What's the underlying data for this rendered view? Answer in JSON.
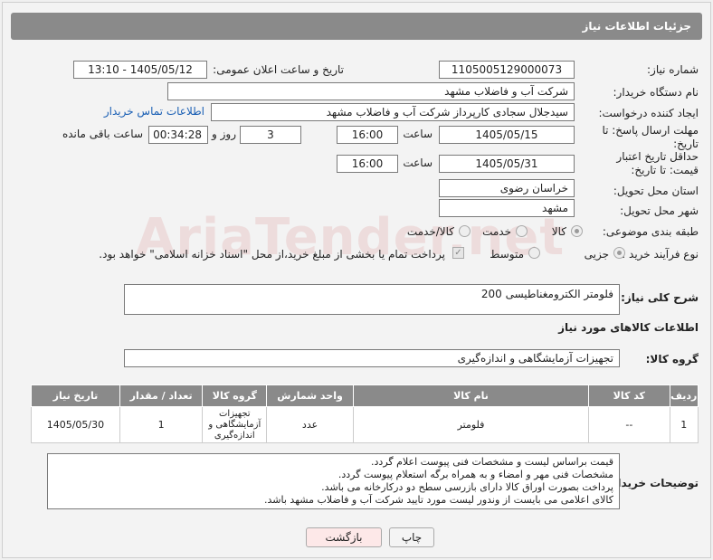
{
  "header": {
    "title": "جزئیات اطلاعات نیاز"
  },
  "watermark": "AriaTender.net",
  "fields": {
    "need_number_label": "شماره نیاز:",
    "need_number": "1105005129000073",
    "announce_label": "تاریخ و ساعت اعلان عمومی:",
    "announce_value": "1405/05/12 - 13:10",
    "buyer_org_label": "نام دستگاه خریدار:",
    "buyer_org": "شرکت آب و فاضلاب مشهد",
    "creator_label": "ایجاد کننده درخواست:",
    "creator": "سیدجلال سجادی کارپرداز شرکت آب و فاضلاب مشهد",
    "contact_link": "اطلاعات تماس خریدار",
    "deadline_label": "مهلت ارسال پاسخ: تا تاریخ:",
    "deadline_date": "1405/05/15",
    "time_word": "ساعت",
    "deadline_time": "16:00",
    "days": "3",
    "days_word": "روز و",
    "remaining": "00:34:28",
    "remaining_word": "ساعت باقی مانده",
    "validity_label": "حداقل تاریخ اعتبار قیمت: تا تاریخ:",
    "validity_date": "1405/05/31",
    "validity_time": "16:00",
    "province_label": "استان محل تحویل:",
    "province": "خراسان رضوی",
    "city_label": "شهر محل تحویل:",
    "city": "مشهد",
    "category_label": "طبقه بندی موضوعی:",
    "cat_goods": "کالا",
    "cat_service": "خدمت",
    "cat_both": "کالا/خدمت",
    "process_label": "نوع فرآیند خرید :",
    "proc_partial": "جزیی",
    "proc_medium": "متوسط",
    "payment_note": "پرداخت تمام یا بخشی از مبلغ خرید،از محل \"اسناد خزانه اسلامی\" خواهد بود."
  },
  "general_desc_label": "شرح کلی نیاز:",
  "general_desc": "فلومتر الکترومغناطیسی 200",
  "goods_section_title": "اطلاعات کالاهای مورد نیاز",
  "goods_group_label": "گروه کالا:",
  "goods_group": "تجهیزات آزمایشگاهی و اندازه‌گیری",
  "table": {
    "headers": [
      "ردیف",
      "کد کالا",
      "نام کالا",
      "واحد شمارش",
      "گروه کالا",
      "تعداد / مقدار",
      "تاریخ نیاز"
    ],
    "rows": [
      [
        "1",
        "--",
        "فلومتر",
        "عدد",
        "تجهیزات آزمایشگاهی و اندازه‌گیری",
        "1",
        "1405/05/30"
      ]
    ]
  },
  "buyer_notes_label": "توضیحات خریدار:",
  "buyer_notes": "قیمت براساس لیست و مشخصات فنی پیوست اعلام گردد.\nمشخصات فنی مهر و امضاء و به همراه برگه استعلام پیوست گردد.\nپرداخت بصورت اوراق کالا دارای بازرسی سطح دو درکارخانه می باشد.\nکالای اعلامی می بایست از وندور لیست مورد تایید شرکت آب و فاضلاب مشهد باشد.",
  "buttons": {
    "print": "چاپ",
    "back": "بازگشت"
  },
  "colors": {
    "header_bg": "#8a8a8a",
    "link": "#1a5fb4",
    "back_bg": "#fde8e8"
  }
}
